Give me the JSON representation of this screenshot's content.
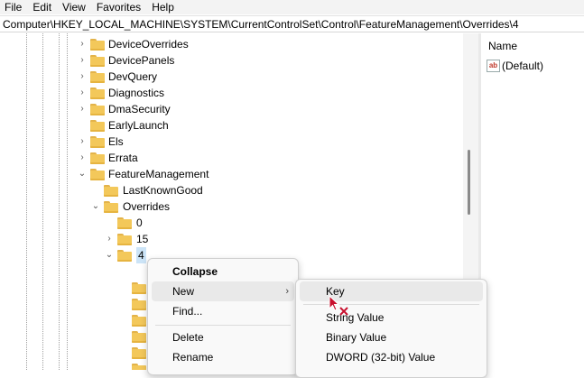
{
  "menubar": {
    "items": [
      "File",
      "Edit",
      "View",
      "Favorites",
      "Help"
    ]
  },
  "address": {
    "path": "Computer\\HKEY_LOCAL_MACHINE\\SYSTEM\\CurrentControlSet\\Control\\FeatureManagement\\Overrides\\4"
  },
  "tree": {
    "items": [
      {
        "label": "DeviceOverrides",
        "chevron": "›"
      },
      {
        "label": "DevicePanels",
        "chevron": "›"
      },
      {
        "label": "DevQuery",
        "chevron": "›"
      },
      {
        "label": "Diagnostics",
        "chevron": "›"
      },
      {
        "label": "DmaSecurity",
        "chevron": "›"
      },
      {
        "label": "EarlyLaunch",
        "chevron": ""
      },
      {
        "label": "Els",
        "chevron": "›"
      },
      {
        "label": "Errata",
        "chevron": "›"
      },
      {
        "label": "FeatureManagement",
        "chevron": "⌄"
      },
      {
        "label": "LastKnownGood",
        "chevron": ""
      },
      {
        "label": "Overrides",
        "chevron": "⌄"
      },
      {
        "label": "0",
        "chevron": ""
      },
      {
        "label": "15",
        "chevron": "›"
      },
      {
        "label": "4",
        "chevron": "⌄"
      }
    ]
  },
  "values_pane": {
    "column_name": "Name",
    "icon_text": "ab",
    "entries": [
      {
        "name": "(Default)"
      }
    ]
  },
  "context_menu": {
    "collapse": "Collapse",
    "new": "New",
    "new_arrow": "›",
    "find": "Find...",
    "delete": "Delete",
    "rename": "Rename"
  },
  "new_submenu": {
    "key": "Key",
    "string_value": "String Value",
    "binary_value": "Binary Value",
    "dword_value": "DWORD (32-bit) Value"
  }
}
